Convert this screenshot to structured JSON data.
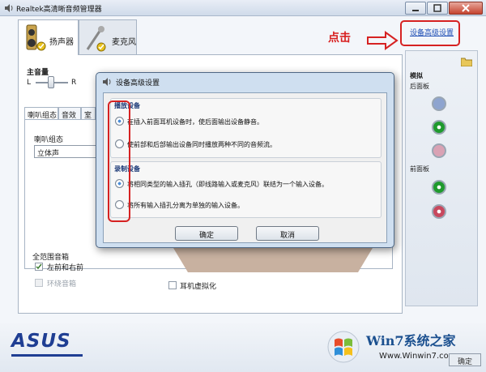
{
  "window": {
    "title": "Realtek高清晰音频管理器"
  },
  "device_tabs": [
    {
      "label": "扬声器"
    },
    {
      "label": "麦克风"
    }
  ],
  "volume": {
    "label": "主音量",
    "left": "L",
    "right": "R"
  },
  "inner_tabs": [
    "喇叭组态",
    "音效",
    "室"
  ],
  "speaker_config": {
    "label": "喇叭组态",
    "value": "立体声"
  },
  "full_range": {
    "label": "全范围音箱",
    "opt_front": "左前和右前",
    "opt_surround": "环绕音箱"
  },
  "headphone_virtual": "耳机虚拟化",
  "annotation": {
    "hint": "点击",
    "link": "设备高级设置",
    "color": "#d62222"
  },
  "right_panel": {
    "analog": "模拟",
    "back_panel": "后面板",
    "front_panel": "前面板",
    "jack_colors_back": [
      "#8ea4cf",
      "#1f9a2e",
      "#d9a2b4"
    ],
    "jack_colors_front": [
      "#1f9a2e",
      "#c8485e"
    ]
  },
  "dialog": {
    "title": "设备高级设置",
    "playback_group": "播放设备",
    "playback_opt1": "在插入前面耳机设备时，使后面输出设备静音。",
    "playback_opt2": "使前部和后部输出设备同时播放两种不同的音频流。",
    "record_group": "录制设备",
    "record_opt1": "将相同类型的输入插孔（即线路输入或麦克风）联结为一个输入设备。",
    "record_opt2": "将所有输入插孔分离为单独的输入设备。",
    "ok": "确定",
    "cancel": "取消"
  },
  "brand": "ASUS",
  "watermark": {
    "name": "Win7系统之家",
    "url": "Www.Winwin7.com"
  },
  "bottom_button": "确定"
}
